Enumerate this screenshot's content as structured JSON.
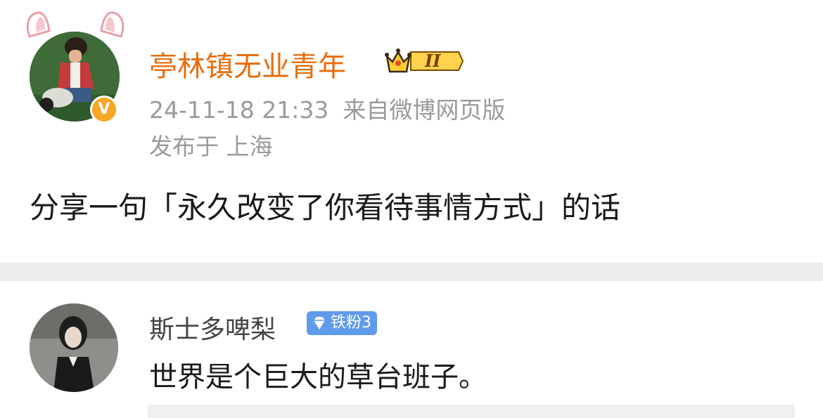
{
  "post": {
    "author": "亭林镇无业青年",
    "level": "II",
    "verified_mark": "V",
    "time": "24-11-18 21:33",
    "source": "来自微博网页版",
    "location": "发布于 上海",
    "content": "分享一句「永久改变了你看待事情方式」的话"
  },
  "comment": {
    "author": "斯士多啤梨",
    "fan_badge": "铁粉3",
    "text": "世界是个巨大的草台班子。"
  },
  "colors": {
    "author_name": "#e86d0c",
    "verified": "#f5a623",
    "fan_badge": "#5f9bea",
    "meta_text": "#9a9a9a"
  }
}
